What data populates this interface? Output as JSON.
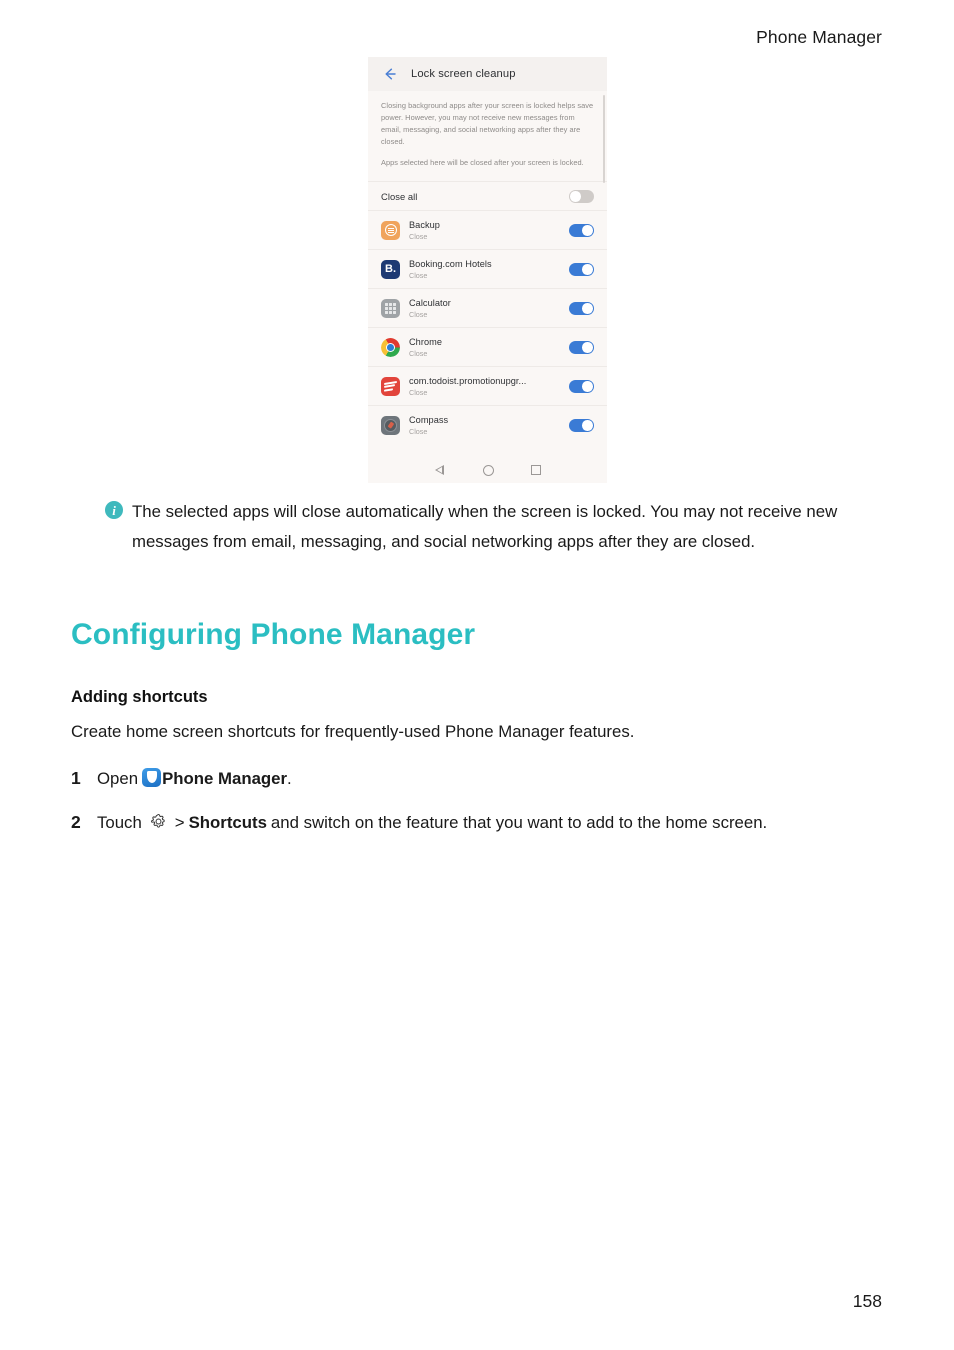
{
  "header": {
    "running_title": "Phone Manager"
  },
  "footer": {
    "page_number": "158"
  },
  "screenshot": {
    "titlebar": {
      "back_icon": "back-arrow-icon",
      "title": "Lock screen cleanup"
    },
    "description": [
      "Closing background apps after your screen is locked helps save power. However, you may not receive new messages from email, messaging, and social networking apps after they are closed.",
      "Apps selected here will be closed after your screen is locked."
    ],
    "close_all": {
      "label": "Close all",
      "toggle_state": "off"
    },
    "apps": [
      {
        "name": "Backup",
        "status": "Close",
        "toggle_state": "on",
        "icon": "backup-app-icon"
      },
      {
        "name": "Booking.com Hotels",
        "status": "Close",
        "toggle_state": "on",
        "icon": "booking-app-icon",
        "icon_text": "B."
      },
      {
        "name": "Calculator",
        "status": "Close",
        "toggle_state": "on",
        "icon": "calculator-app-icon"
      },
      {
        "name": "Chrome",
        "status": "Close",
        "toggle_state": "on",
        "icon": "chrome-app-icon"
      },
      {
        "name": "com.todoist.promotionupgr...",
        "status": "Close",
        "toggle_state": "on",
        "icon": "todoist-app-icon"
      },
      {
        "name": "Compass",
        "status": "Close",
        "toggle_state": "on",
        "icon": "compass-app-icon"
      }
    ],
    "navbar": {
      "back": "nav-back-icon",
      "home": "nav-home-icon",
      "recents": "nav-recents-icon"
    }
  },
  "note": {
    "icon": "info-icon",
    "icon_glyph": "i",
    "text": "The selected apps will close automatically when the screen is locked. You may not receive new messages from email, messaging, and social networking apps after they are closed."
  },
  "section": {
    "heading": "Configuring Phone Manager",
    "subheading": "Adding shortcuts",
    "intro": "Create home screen shortcuts for frequently-used Phone Manager features."
  },
  "steps": [
    {
      "number": "1",
      "text_before": "Open",
      "icon": "phone-manager-app-icon",
      "bold_text": "Phone Manager",
      "text_after": "."
    },
    {
      "number": "2",
      "text_before": "Touch",
      "icon": "settings-gear-icon",
      "separator": ">",
      "bold_text": "Shortcuts",
      "text_after": "and switch on the feature that you want to add to the home screen."
    }
  ],
  "colors": {
    "accent_teal": "#2bbec2",
    "note_icon_teal": "#3fb9bd",
    "toggle_on_blue": "#3a7bd5",
    "toggle_off_gray": "#cfcbc8",
    "screenshot_bg": "#faf7f5"
  }
}
